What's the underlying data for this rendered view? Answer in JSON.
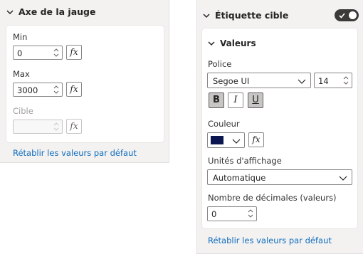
{
  "left": {
    "section_title": "Axe de la jauge",
    "min": {
      "label": "Min",
      "value": "0"
    },
    "max": {
      "label": "Max",
      "value": "3000"
    },
    "target": {
      "label": "Cible",
      "value": ""
    },
    "fx_label": "fx",
    "reset_link": "Rétablir les valeurs par défaut"
  },
  "right": {
    "section_title": "Étiquette cible",
    "toggle_on": true,
    "values_group": {
      "title": "Valeurs",
      "font_label": "Police",
      "font_family": "Segoe UI",
      "font_size": "14",
      "bold_label": "B",
      "italic_label": "I",
      "underline_label": "U",
      "color_label": "Couleur",
      "color_value": "#0b1650",
      "fx_label": "fx",
      "display_units_label": "Unités d'affichage",
      "display_units_value": "Automatique",
      "decimals_label": "Nombre de décimales (valeurs)",
      "decimals_value": "0"
    },
    "reset_link": "Rétablir les valeurs par défaut"
  }
}
